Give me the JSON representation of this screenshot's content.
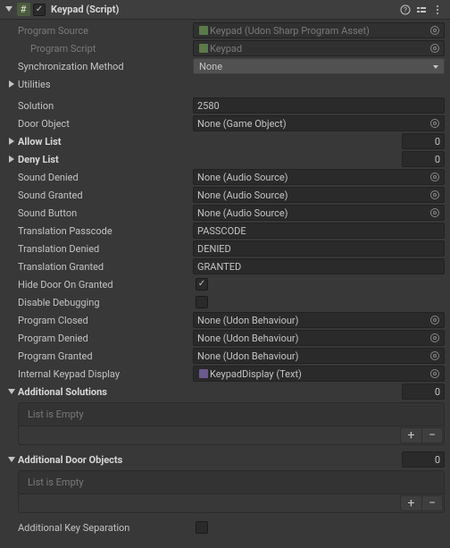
{
  "header": {
    "component_name": "Keypad (Script)",
    "enabled": true
  },
  "fields": {
    "program_source": {
      "label": "Program Source",
      "value": "Keypad (Udon Sharp Program Asset)"
    },
    "program_script": {
      "label": "Program Script",
      "value": "Keypad"
    },
    "sync_method": {
      "label": "Synchronization Method",
      "value": "None"
    },
    "utilities": {
      "label": "Utilities"
    },
    "solution": {
      "label": "Solution",
      "value": "2580"
    },
    "door_object": {
      "label": "Door Object",
      "value": "None (Game Object)"
    },
    "allow_list": {
      "label": "Allow List",
      "count": "0"
    },
    "deny_list": {
      "label": "Deny List",
      "count": "0"
    },
    "sound_denied": {
      "label": "Sound Denied",
      "value": "None (Audio Source)"
    },
    "sound_granted": {
      "label": "Sound Granted",
      "value": "None (Audio Source)"
    },
    "sound_button": {
      "label": "Sound Button",
      "value": "None (Audio Source)"
    },
    "translation_passcode": {
      "label": "Translation Passcode",
      "value": "PASSCODE"
    },
    "translation_denied": {
      "label": "Translation Denied",
      "value": "DENIED"
    },
    "translation_granted": {
      "label": "Translation Granted",
      "value": "GRANTED"
    },
    "hide_door": {
      "label": "Hide Door On Granted",
      "checked": true
    },
    "disable_debugging": {
      "label": "Disable Debugging",
      "checked": false
    },
    "program_closed": {
      "label": "Program Closed",
      "value": "None (Udon Behaviour)"
    },
    "program_denied": {
      "label": "Program Denied",
      "value": "None (Udon Behaviour)"
    },
    "program_granted": {
      "label": "Program Granted",
      "value": "None (Udon Behaviour)"
    },
    "internal_keypad_display": {
      "label": "Internal Keypad Display",
      "value": "KeypadDisplay (Text)"
    },
    "additional_solutions": {
      "label": "Additional Solutions",
      "count": "0",
      "empty_text": "List is Empty"
    },
    "additional_door_objects": {
      "label": "Additional Door Objects",
      "count": "0",
      "empty_text": "List is Empty"
    },
    "additional_key_separation": {
      "label": "Additional Key Separation",
      "checked": false
    }
  },
  "icons": {
    "hash": "#",
    "plus": "+",
    "minus": "−"
  }
}
